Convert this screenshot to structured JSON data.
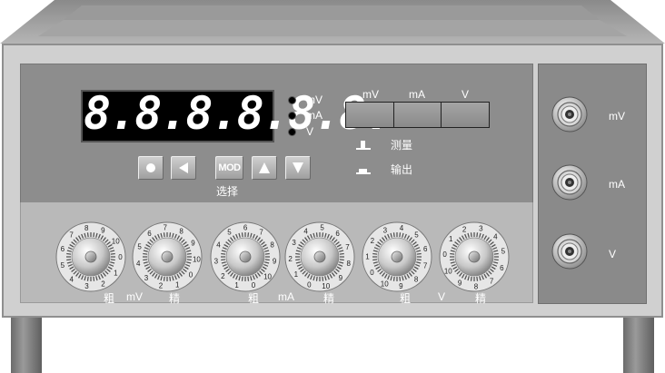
{
  "display": {
    "digits": "8.8.8.8.8.8."
  },
  "indicators": [
    {
      "label": "mV"
    },
    {
      "label": "mA"
    },
    {
      "label": "V"
    }
  ],
  "keys": {
    "mod_label": "MOD",
    "select_label": "选择"
  },
  "range_buttons": [
    {
      "label": "mV"
    },
    {
      "label": "mA"
    },
    {
      "label": "V"
    }
  ],
  "mode_legend": {
    "measure_label": "测量",
    "output_label": "输出"
  },
  "knobs": [
    {
      "unit": "mV",
      "coarse_label": "粗",
      "fine_label": "精"
    },
    {
      "unit": "mA",
      "coarse_label": "粗",
      "fine_label": "精"
    },
    {
      "unit": "V",
      "coarse_label": "粗",
      "fine_label": "精"
    }
  ],
  "jacks": [
    {
      "label": "mV"
    },
    {
      "label": "mA"
    },
    {
      "label": "V"
    }
  ],
  "colors": {
    "panel_dark": "#8d8d8d",
    "panel_light": "#b9b9b9",
    "display_bg": "#000000",
    "text": "#ffffff"
  }
}
